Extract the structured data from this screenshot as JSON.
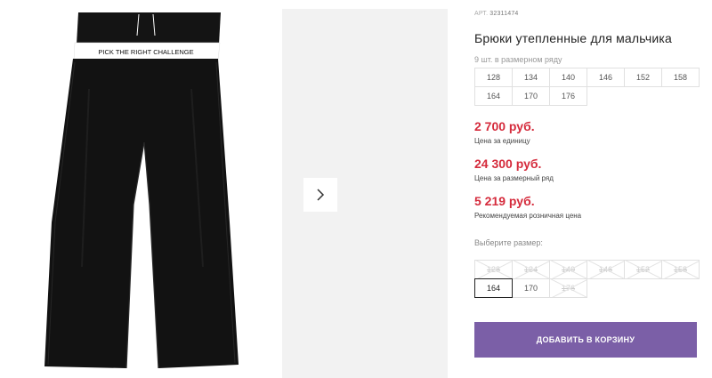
{
  "product": {
    "art_label": "АРТ.",
    "art_value": "32311474",
    "title": "Брюки утепленные для мальчика",
    "image_name": "black-track-pants",
    "waistband_text": "PICK THE RIGHT CHALLENGE"
  },
  "size_row": {
    "count_text": "9 шт. в размерном ряду",
    "sizes": [
      "128",
      "134",
      "140",
      "146",
      "152",
      "158",
      "164",
      "170",
      "176"
    ]
  },
  "prices": [
    {
      "value": "2 700 руб.",
      "note": "Цена за единицу"
    },
    {
      "value": "24 300 руб.",
      "note": "Цена за размерный ряд"
    },
    {
      "value": "5 219 руб.",
      "note": "Рекомендуемая розничная цена"
    }
  ],
  "size_picker": {
    "label": "Выберите размер:",
    "options": [
      {
        "size": "128",
        "state": "unavailable"
      },
      {
        "size": "134",
        "state": "unavailable"
      },
      {
        "size": "140",
        "state": "unavailable"
      },
      {
        "size": "146",
        "state": "unavailable"
      },
      {
        "size": "152",
        "state": "unavailable"
      },
      {
        "size": "158",
        "state": "unavailable"
      },
      {
        "size": "164",
        "state": "selected"
      },
      {
        "size": "170",
        "state": "available"
      },
      {
        "size": "176",
        "state": "unavailable"
      }
    ]
  },
  "cart_button": {
    "label": "ДОБАВИТЬ В КОРЗИНУ"
  },
  "gallery": {
    "next_icon": "chevron-right-icon"
  },
  "colors": {
    "price": "#d52b3c",
    "button": "#7b5fa7"
  }
}
